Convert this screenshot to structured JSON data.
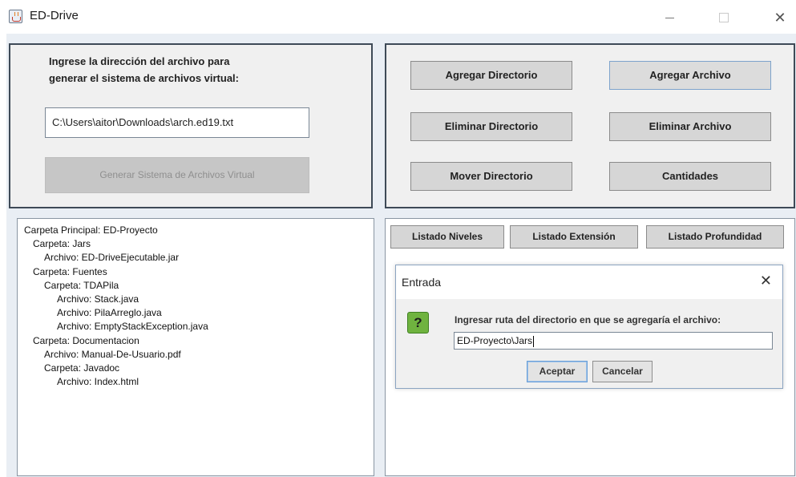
{
  "window": {
    "title": "ED-Drive",
    "close_glyph": "✕"
  },
  "input_panel": {
    "prompt_line1": "Ingrese la dirección del archivo para",
    "prompt_line2": "generar el sistema de archivos virtual:",
    "path_value": "C:\\Users\\aitor\\Downloads\\arch.ed19.txt",
    "generate_label": "Generar Sistema de Archivos Virtual"
  },
  "actions": {
    "add_directory": "Agregar Directorio",
    "add_file": "Agregar Archivo",
    "delete_directory": "Eliminar Directorio",
    "delete_file": "Eliminar Archivo",
    "move_directory": "Mover Directorio",
    "counts": "Cantidades"
  },
  "tree": [
    "Carpeta Principal: ED-Proyecto",
    "Carpeta: Jars",
    "Archivo: ED-DriveEjecutable.jar",
    "Carpeta: Fuentes",
    "Carpeta: TDAPila",
    "Archivo: Stack.java",
    "Archivo: PilaArreglo.java",
    "Archivo: EmptyStackException.java",
    "Carpeta: Documentacion",
    "Archivo: Manual-De-Usuario.pdf",
    "Carpeta: Javadoc",
    "Archivo: Index.html"
  ],
  "listing": {
    "levels": "Listado Niveles",
    "extension": "Listado Extensión",
    "depth": "Listado Profundidad"
  },
  "dialog": {
    "title": "Entrada",
    "icon_glyph": "?",
    "close_glyph": "✕",
    "message": "Ingresar ruta del directorio en que se agregaría el archivo:",
    "input_value": "ED-Proyecto\\Jars",
    "accept": "Aceptar",
    "cancel": "Cancelar"
  },
  "colors": {
    "panel_border": "#3e4a57",
    "background": "#e9eef4",
    "button": "#d6d6d6",
    "question_icon": "#6fb33f"
  }
}
